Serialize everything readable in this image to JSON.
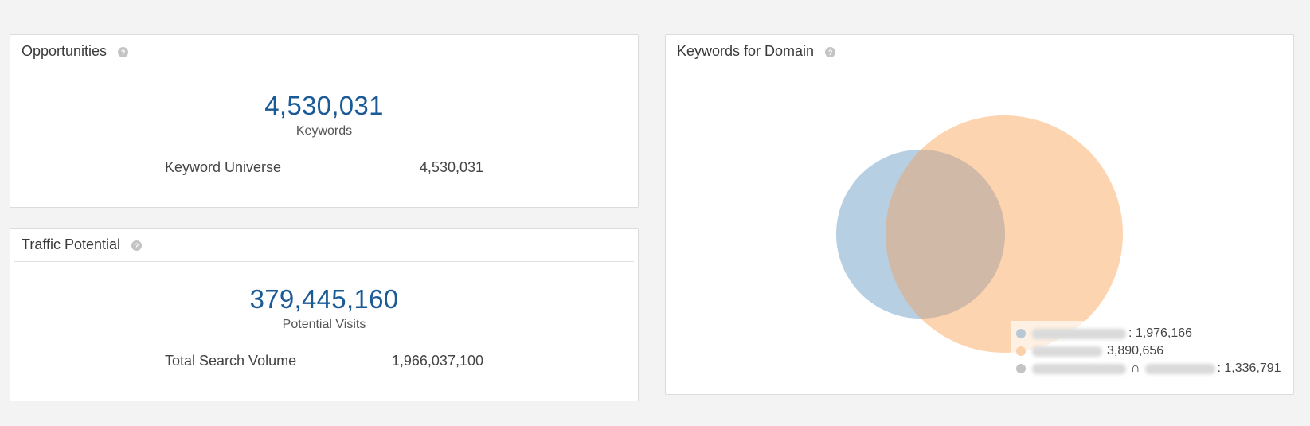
{
  "opportunities": {
    "title": "Opportunities",
    "help_glyph": "?",
    "big_value": "4,530,031",
    "big_label": "Keywords",
    "stat_label": "Keyword Universe",
    "stat_value": "4,530,031"
  },
  "traffic": {
    "title": "Traffic Potential",
    "help_glyph": "?",
    "big_value": "379,445,160",
    "big_label": "Potential Visits",
    "stat_label": "Total Search Volume",
    "stat_value": "1,966,037,100"
  },
  "keywords_domain": {
    "title": "Keywords for Domain",
    "help_glyph": "?",
    "legend": [
      {
        "value_text": ": 1,976,166",
        "color": "#a9c7de"
      },
      {
        "value_text": "3,890,656",
        "color": "#fdc99c"
      },
      {
        "intersect_symbol": "∩",
        "value_text": ": 1,336,791",
        "color": "#c4c4c4"
      }
    ]
  },
  "chart_data": {
    "type": "venn",
    "sets": [
      {
        "color": "#a9c7de",
        "value": 1976166
      },
      {
        "color": "#fdc99c",
        "value": 3890656
      }
    ],
    "intersection": 1336791
  }
}
